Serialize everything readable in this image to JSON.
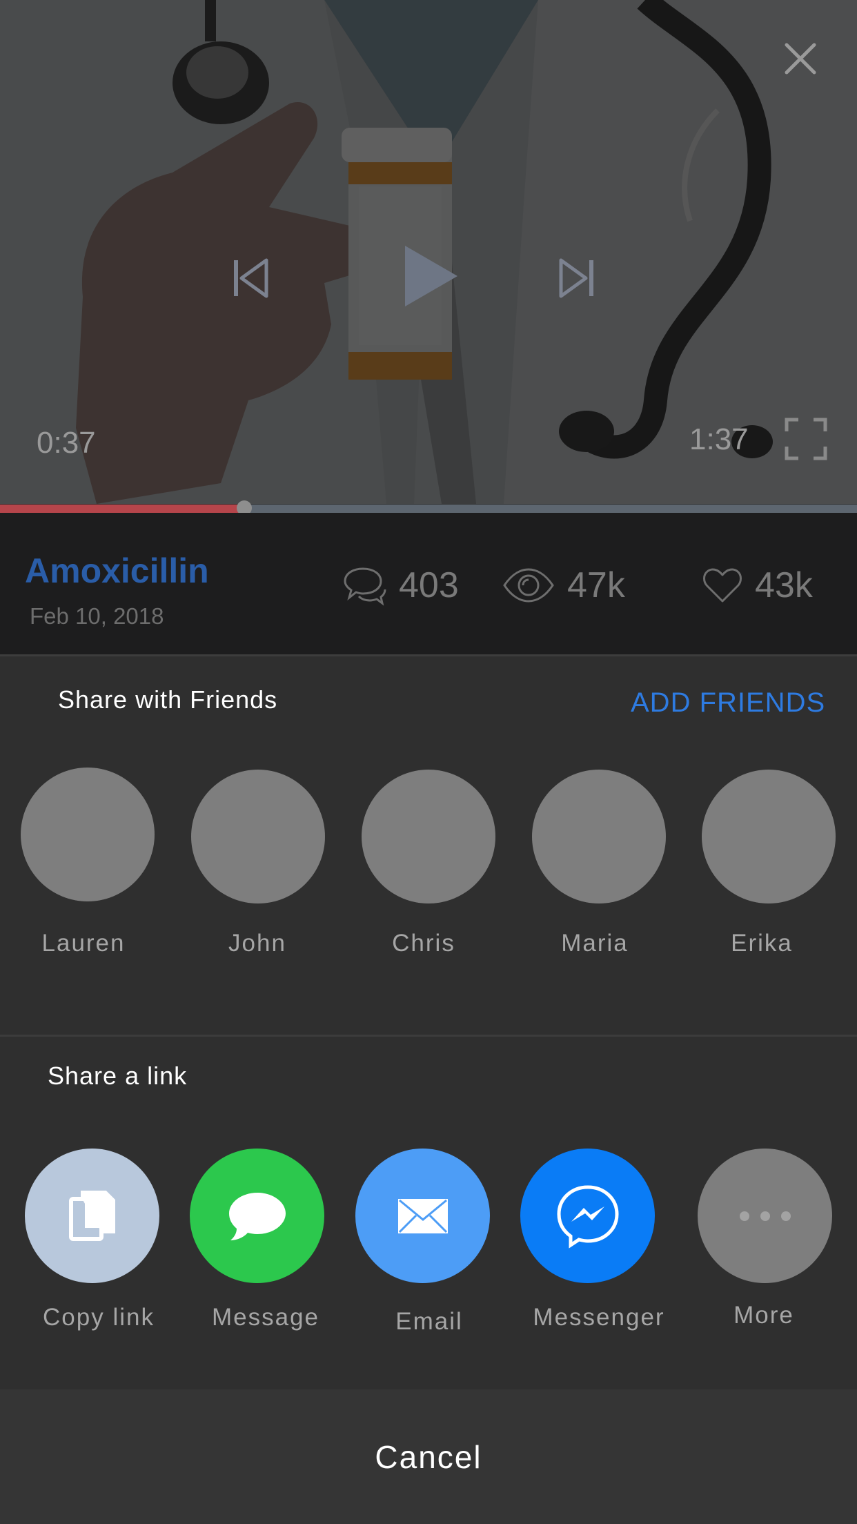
{
  "player": {
    "current_time": "0:37",
    "duration": "1:37",
    "progress_fraction": 0.285,
    "progress_color": "#b6454b",
    "icons": [
      "close-icon",
      "previous-icon",
      "play-icon",
      "next-icon",
      "fullscreen-icon"
    ]
  },
  "video": {
    "title": "Amoxicillin",
    "date": "Feb 10, 2018",
    "title_color": "#2a5da8",
    "stats": {
      "comments": "403",
      "views": "47k",
      "likes": "43k"
    }
  },
  "share_friends": {
    "title": "Share with Friends",
    "add_friends_label": "ADD FRIENDS",
    "accent_color": "#2e7be1",
    "friends": [
      {
        "name": "Lauren"
      },
      {
        "name": "John"
      },
      {
        "name": "Chris"
      },
      {
        "name": "Maria"
      },
      {
        "name": "Erika"
      }
    ]
  },
  "share_link": {
    "title": "Share a link",
    "options": [
      {
        "label": "Copy link",
        "icon": "copy-icon",
        "color": "#b8c8dc"
      },
      {
        "label": "Message",
        "icon": "message-icon",
        "color": "#2cc84d"
      },
      {
        "label": "Email",
        "icon": "email-icon",
        "color": "#4d9df6"
      },
      {
        "label": "Messenger",
        "icon": "messenger-icon",
        "color": "#0a7cf6"
      },
      {
        "label": "More",
        "icon": "more-icon",
        "color": "#7e7e7e"
      }
    ]
  },
  "cancel_label": "Cancel"
}
